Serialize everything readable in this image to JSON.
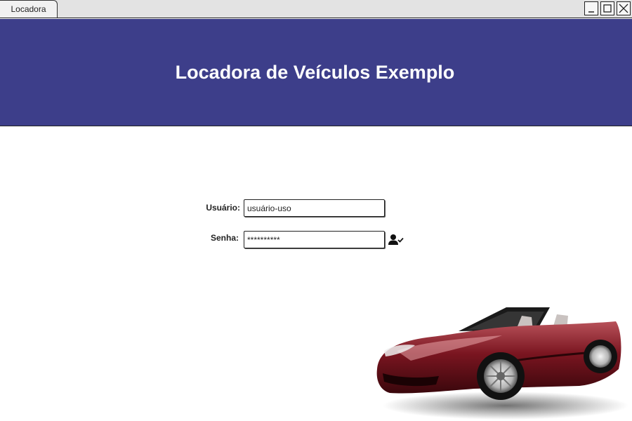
{
  "window": {
    "tab_title": "Locadora",
    "controls": [
      "minimize-icon",
      "maximize-icon",
      "close-icon"
    ]
  },
  "header": {
    "title": "Locadora de Veículos Exemplo",
    "background_color": "#3d3e8a"
  },
  "login": {
    "user_label": "Usuário:",
    "user_value": "usuário-uso",
    "password_label": "Senha:",
    "password_value": "**********",
    "confirm_icon": "user-check-icon"
  },
  "illustration": {
    "icon": "red-convertible-car",
    "color": "#7a1520"
  }
}
